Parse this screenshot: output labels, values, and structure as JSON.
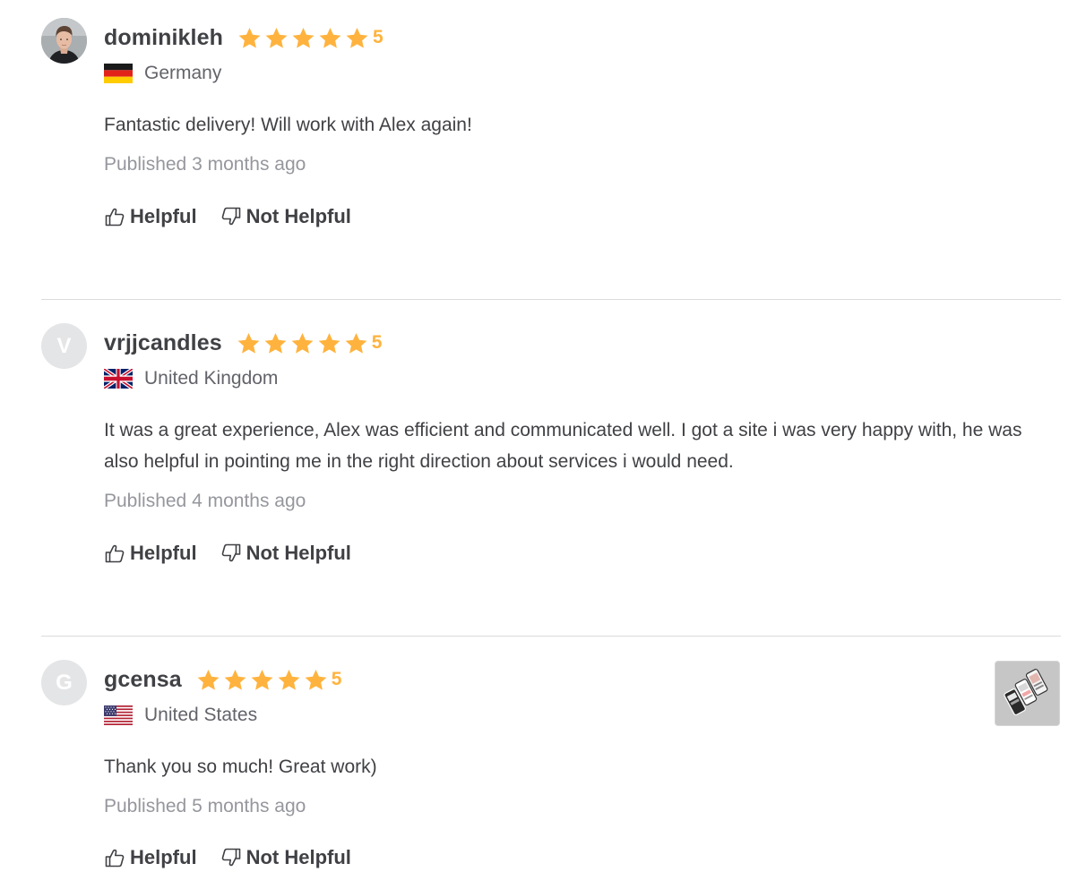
{
  "rating_color": "#ffb33e",
  "reviews": [
    {
      "username": "dominikleh",
      "avatar": "profile-photo",
      "rating": "5",
      "stars": 5,
      "country": "Germany",
      "flag_icon": "germany-flag-icon",
      "comment": "Fantastic delivery! Will work with Alex again!",
      "published": "Published 3 months ago",
      "helpful_label": "Helpful",
      "not_helpful_label": "Not Helpful"
    },
    {
      "username": "vrjjcandles",
      "avatar_letter": "V",
      "rating": "5",
      "stars": 5,
      "country": "United Kingdom",
      "flag_icon": "uk-flag-icon",
      "comment": "It was a great experience, Alex was efficient and communicated well. I got a site i was very happy with, he was also helpful in pointing me in the right direction about services i would need.",
      "published": "Published 4 months ago",
      "helpful_label": "Helpful",
      "not_helpful_label": "Not Helpful"
    },
    {
      "username": "gcensa",
      "avatar_letter": "G",
      "rating": "5",
      "stars": 5,
      "country": "United States",
      "flag_icon": "us-flag-icon",
      "comment": "Thank you so much! Great work)",
      "published": "Published 5 months ago",
      "helpful_label": "Helpful",
      "not_helpful_label": "Not Helpful",
      "attachment": "phone-screens-thumbnail"
    }
  ]
}
